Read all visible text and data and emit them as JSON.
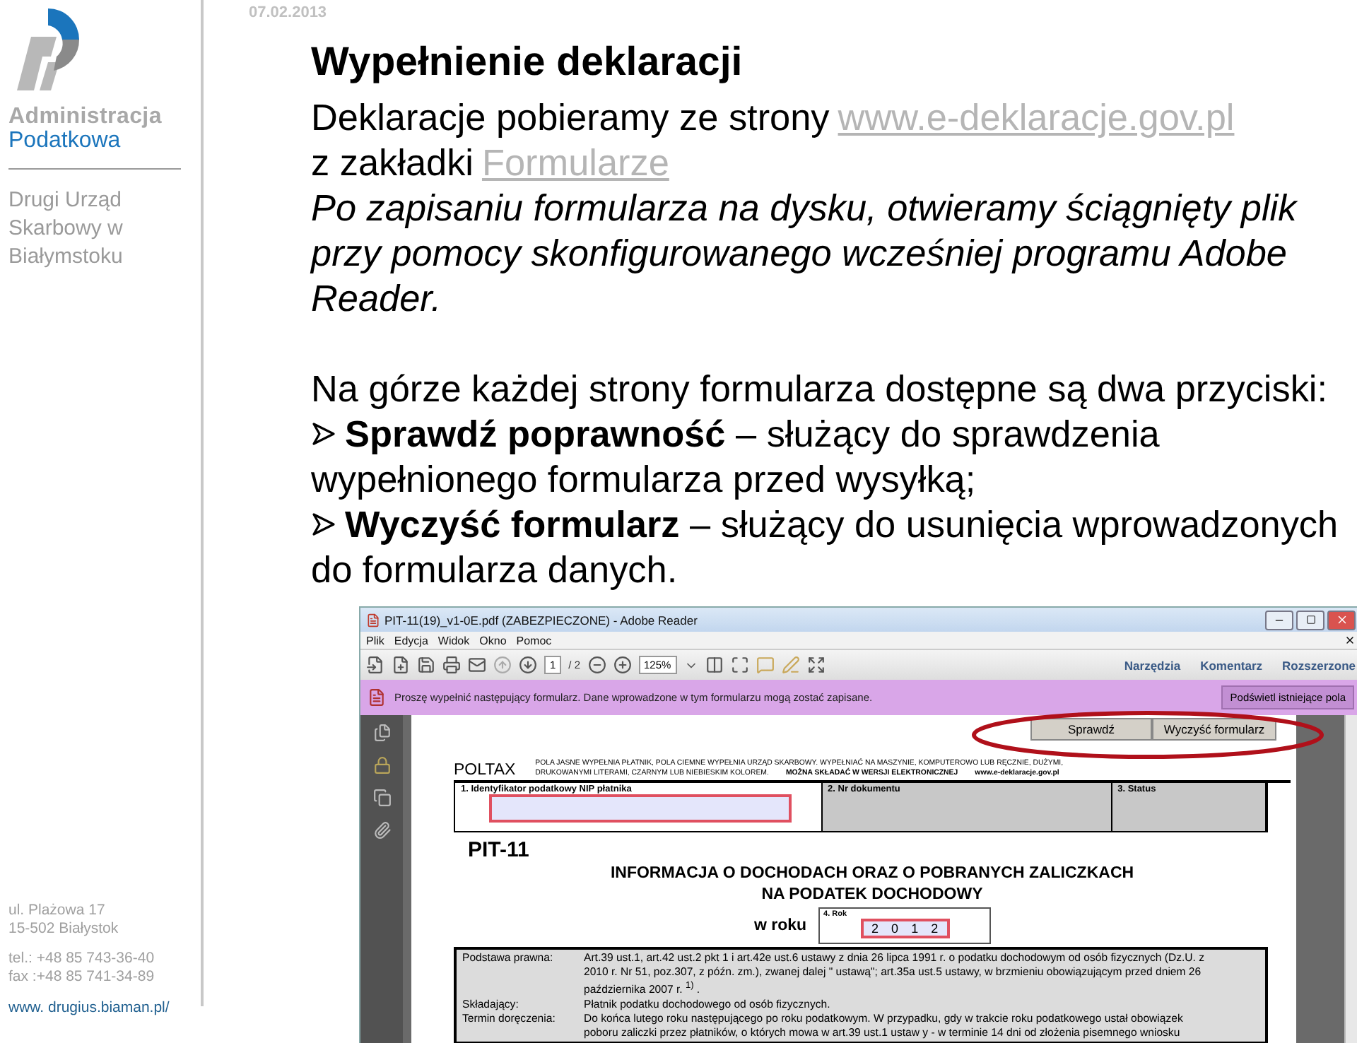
{
  "date": "07.02.2013",
  "sidebar": {
    "logo_top": "Administracja",
    "logo_bottom": "Podatkowa",
    "office": "Drugi Urząd Skarbowy w Białymstoku",
    "address": [
      "ul.  Plażowa 17",
      "15-502 Białystok"
    ],
    "contact": [
      "tel.: +48 85 743-36-40",
      "fax :+48 85 741-34-89"
    ],
    "website": "www. drugius.biaman.pl/"
  },
  "title": "Wypełnienie deklaracji",
  "intro": [
    {
      "text": "Deklaracje pobieramy ze strony",
      "link": "www.e-deklaracje.gov.pl"
    },
    {
      "text": "z zakładki",
      "link": "Formularze"
    }
  ],
  "note": "Po zapisaniu formularza na dysku, otwieramy ściągnięty plik przy pomocy skonfigurowanego wcześniej programu Adobe Reader.",
  "lead": "Na górze każdej strony formularza dostępne są dwa przyciski:",
  "bullets": [
    {
      "term": "Sprawdź poprawność",
      "lines": [
        "– służący do sprawdzenia",
        "wypełnionego formularza przed wysyłką;"
      ]
    },
    {
      "term": "Wyczyść formularz",
      "lines": [
        "– służący do usunięcia wprowadzonych",
        "do formularza danych."
      ]
    }
  ],
  "screenshot": {
    "window_title": "PIT-11(19)_v1-0E.pdf (ZABEZPIECZONE) - Adobe Reader",
    "menu": [
      "Plik",
      "Edycja",
      "Widok",
      "Okno",
      "Pomoc"
    ],
    "page": "1",
    "page_total": "/ 2",
    "zoom": "125%",
    "panels": [
      "Narzędzia",
      "Komentarz",
      "Rozszerzone"
    ],
    "info": "Proszę wypełnić następujący formularz. Dane wprowadzone w tym formularzu mogą zostać zapisane.",
    "highlight_button": "Podświetl istniejące pola",
    "form_buttons": [
      "Sprawdź",
      "Wyczyść formularz"
    ],
    "poltax": "POLTAX",
    "notice": "POLA JASNE WYPEŁNIA PŁATNIK, POLA CIEMNE WYPEŁNIA URZĄD SKARBOWY. WYPEŁNIAĆ NA MASZYNIE, KOMPUTEROWO LUB RĘCZNIE, DUŻYMI,",
    "notice_2": "DRUKOWANYMI LITERAMI, CZARNYM LUB NIEBIESKIM KOLOREM.",
    "notice_bold": "MOŻNA SKŁADAĆ W WERSJI ELEKTRONICZNEJ",
    "notice_site": "www.e-deklaracje.gov.pl",
    "fields": [
      {
        "label": "1. Identyfikator podatkowy NIP płatnika",
        "kind": "input"
      },
      {
        "label": "2. Nr dokumentu",
        "kind": "office"
      },
      {
        "label": "3. Status",
        "kind": "office"
      }
    ],
    "form_code": "PIT-11",
    "heading": [
      "INFORMACJA O DOCHODACH ORAZ O POBRANYCH ZALICZKACH",
      "NA PODATEK DOCHODOWY"
    ],
    "year_label": "w roku",
    "year_field": "4. Rok",
    "year_digits": [
      "2",
      "0",
      "1",
      "2"
    ],
    "rows": [
      {
        "label": "Podstawa prawna:",
        "lines": [
          "Art.39 ust.1, art.42 ust.2 pkt 1 i art.42e ust.6 ustawy z dnia 26 lipca 1991 r. o podatku dochodowym od osób fizycznych (Dz.U. z",
          "2010 r. Nr 51, poz.307, z późn. zm.), zwanej dalej  \" ustawą\"; art.35a ust.5 ustawy, w brzmieniu obowiązującym przed dniem 26",
          "października 2007 r. $^{1)}$ ."
        ]
      },
      {
        "label": "Składający:",
        "lines": [
          "Płatnik podatku dochodowego od osób fizycznych."
        ]
      },
      {
        "label": "Termin doręczenia:",
        "lines": [
          "Do końca lutego roku następującego  po roku  podatkowym. W  przypadku,  gdy  w trakcie roku  podatkowego ustał obowiązek",
          "poboru zaliczki  przez  płatników, o których mowa w art.39 ust.1 ustaw y  - w terminie 14 dni od złożenia  pisemnego wniosku"
        ]
      }
    ]
  }
}
